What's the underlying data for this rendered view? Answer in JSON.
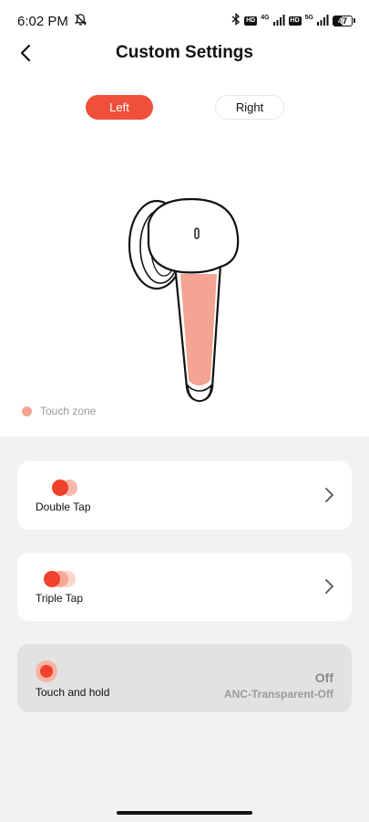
{
  "status_bar": {
    "time": "6:02 PM",
    "network_1": "4G",
    "network_2": "5G",
    "hd_badge": "HD",
    "battery": "47"
  },
  "header": {
    "title": "Custom Settings"
  },
  "side_toggle": {
    "left_label": "Left",
    "right_label": "Right",
    "selected": "Left"
  },
  "legend": {
    "label": "Touch zone",
    "color": "#f3a492"
  },
  "gestures": [
    {
      "label": "Double Tap"
    },
    {
      "label": "Triple Tap"
    },
    {
      "label": "Touch and hold",
      "value": "Off",
      "subvalue": "ANC-Transparent-Off",
      "disabled": true
    }
  ],
  "colors": {
    "accent": "#f0503a",
    "touch_zone": "#f3a492",
    "panel_bg": "#f2f2f2"
  }
}
